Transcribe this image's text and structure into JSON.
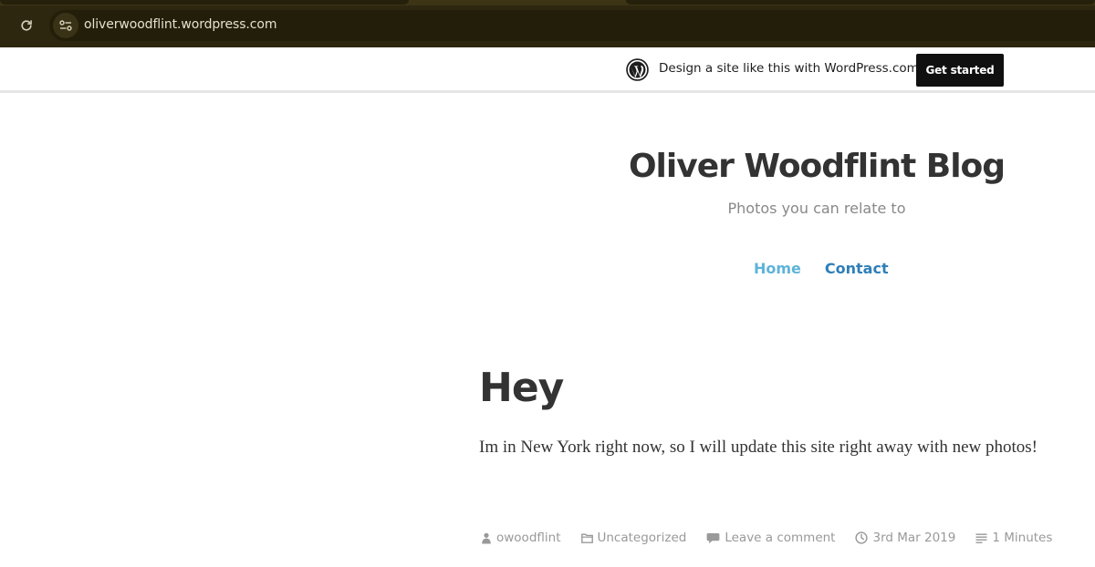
{
  "browser": {
    "url": "oliverwoodflint.wordpress.com",
    "reload_icon": "reload-icon",
    "site_info_icon": "site-settings-icon"
  },
  "banner": {
    "logo_icon": "wordpress-logo-icon",
    "text": "Design a site like this with WordPress.com",
    "button_label": "Get started"
  },
  "site": {
    "title": "Oliver Woodflint Blog",
    "tagline": "Photos you can relate to",
    "nav": [
      {
        "label": "Home",
        "color": "#5fb3d8"
      },
      {
        "label": "Contact",
        "color": "#2e7fb8"
      }
    ]
  },
  "post": {
    "title": "Hey",
    "body": "Im in New York right now, so I will update this site right away with new photos!",
    "meta": {
      "author": "owoodflint",
      "category": "Uncategorized",
      "comments": "Leave a comment",
      "date": "3rd Mar 2019",
      "reading_time": "1 Minutes"
    }
  }
}
